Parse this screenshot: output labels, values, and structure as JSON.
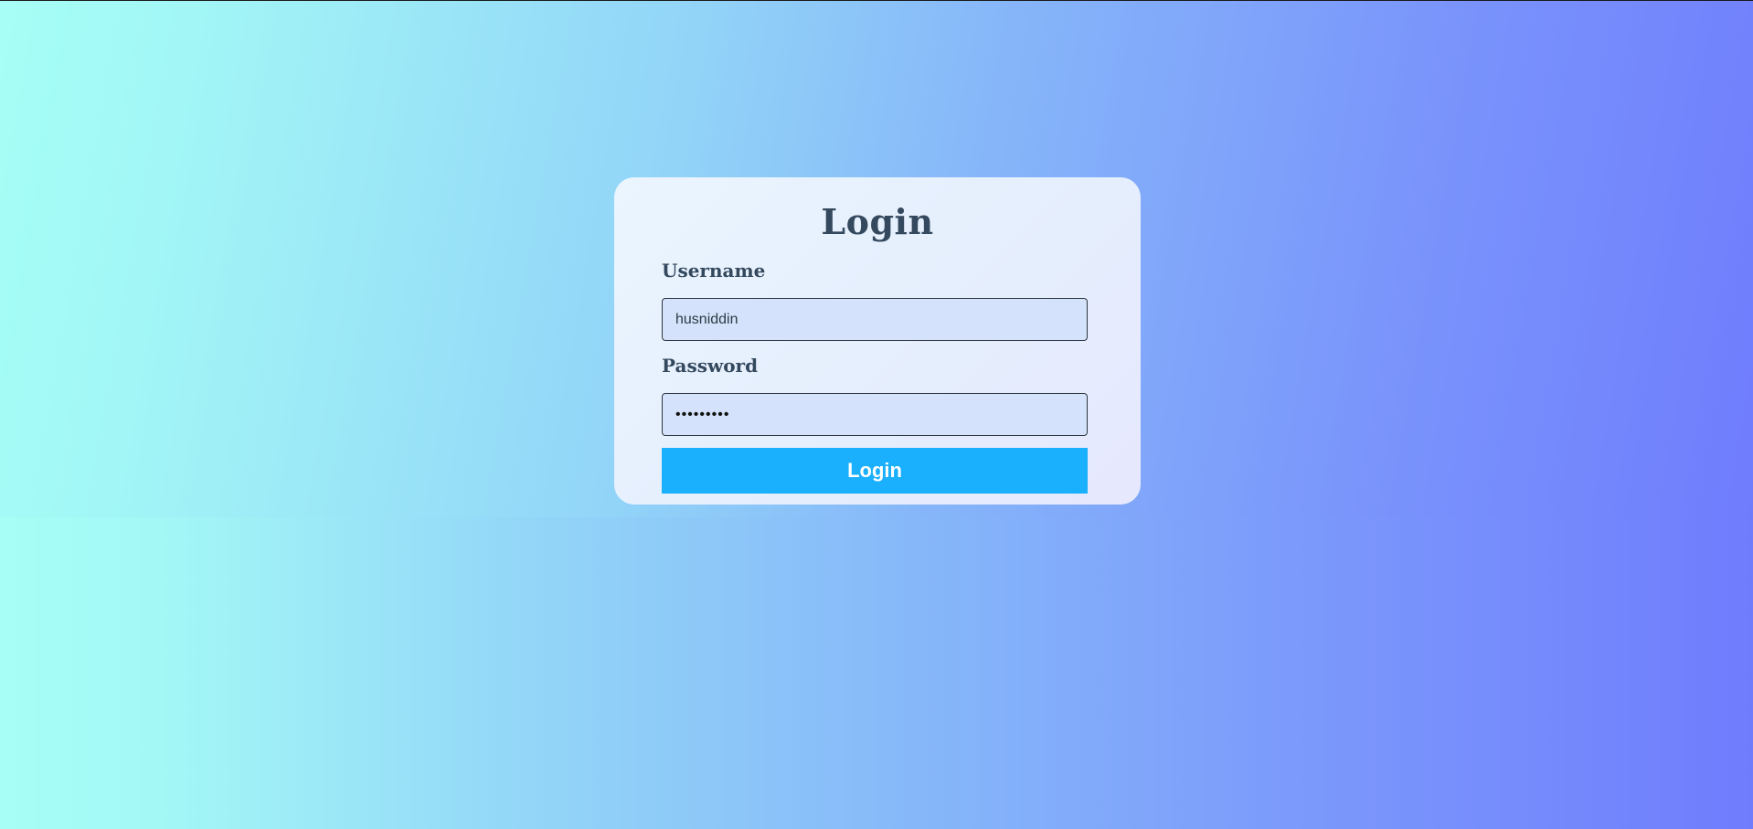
{
  "background": {
    "gradient_start": "#a6fef6",
    "gradient_end": "#6f7dfd"
  },
  "login_form": {
    "title": "Login",
    "username_label": "Username",
    "username_value": "husniddin",
    "password_label": "Password",
    "password_value": "husniddin",
    "submit_label": "Login",
    "accent_color": "#1ab0fd",
    "text_color": "#34495e"
  }
}
